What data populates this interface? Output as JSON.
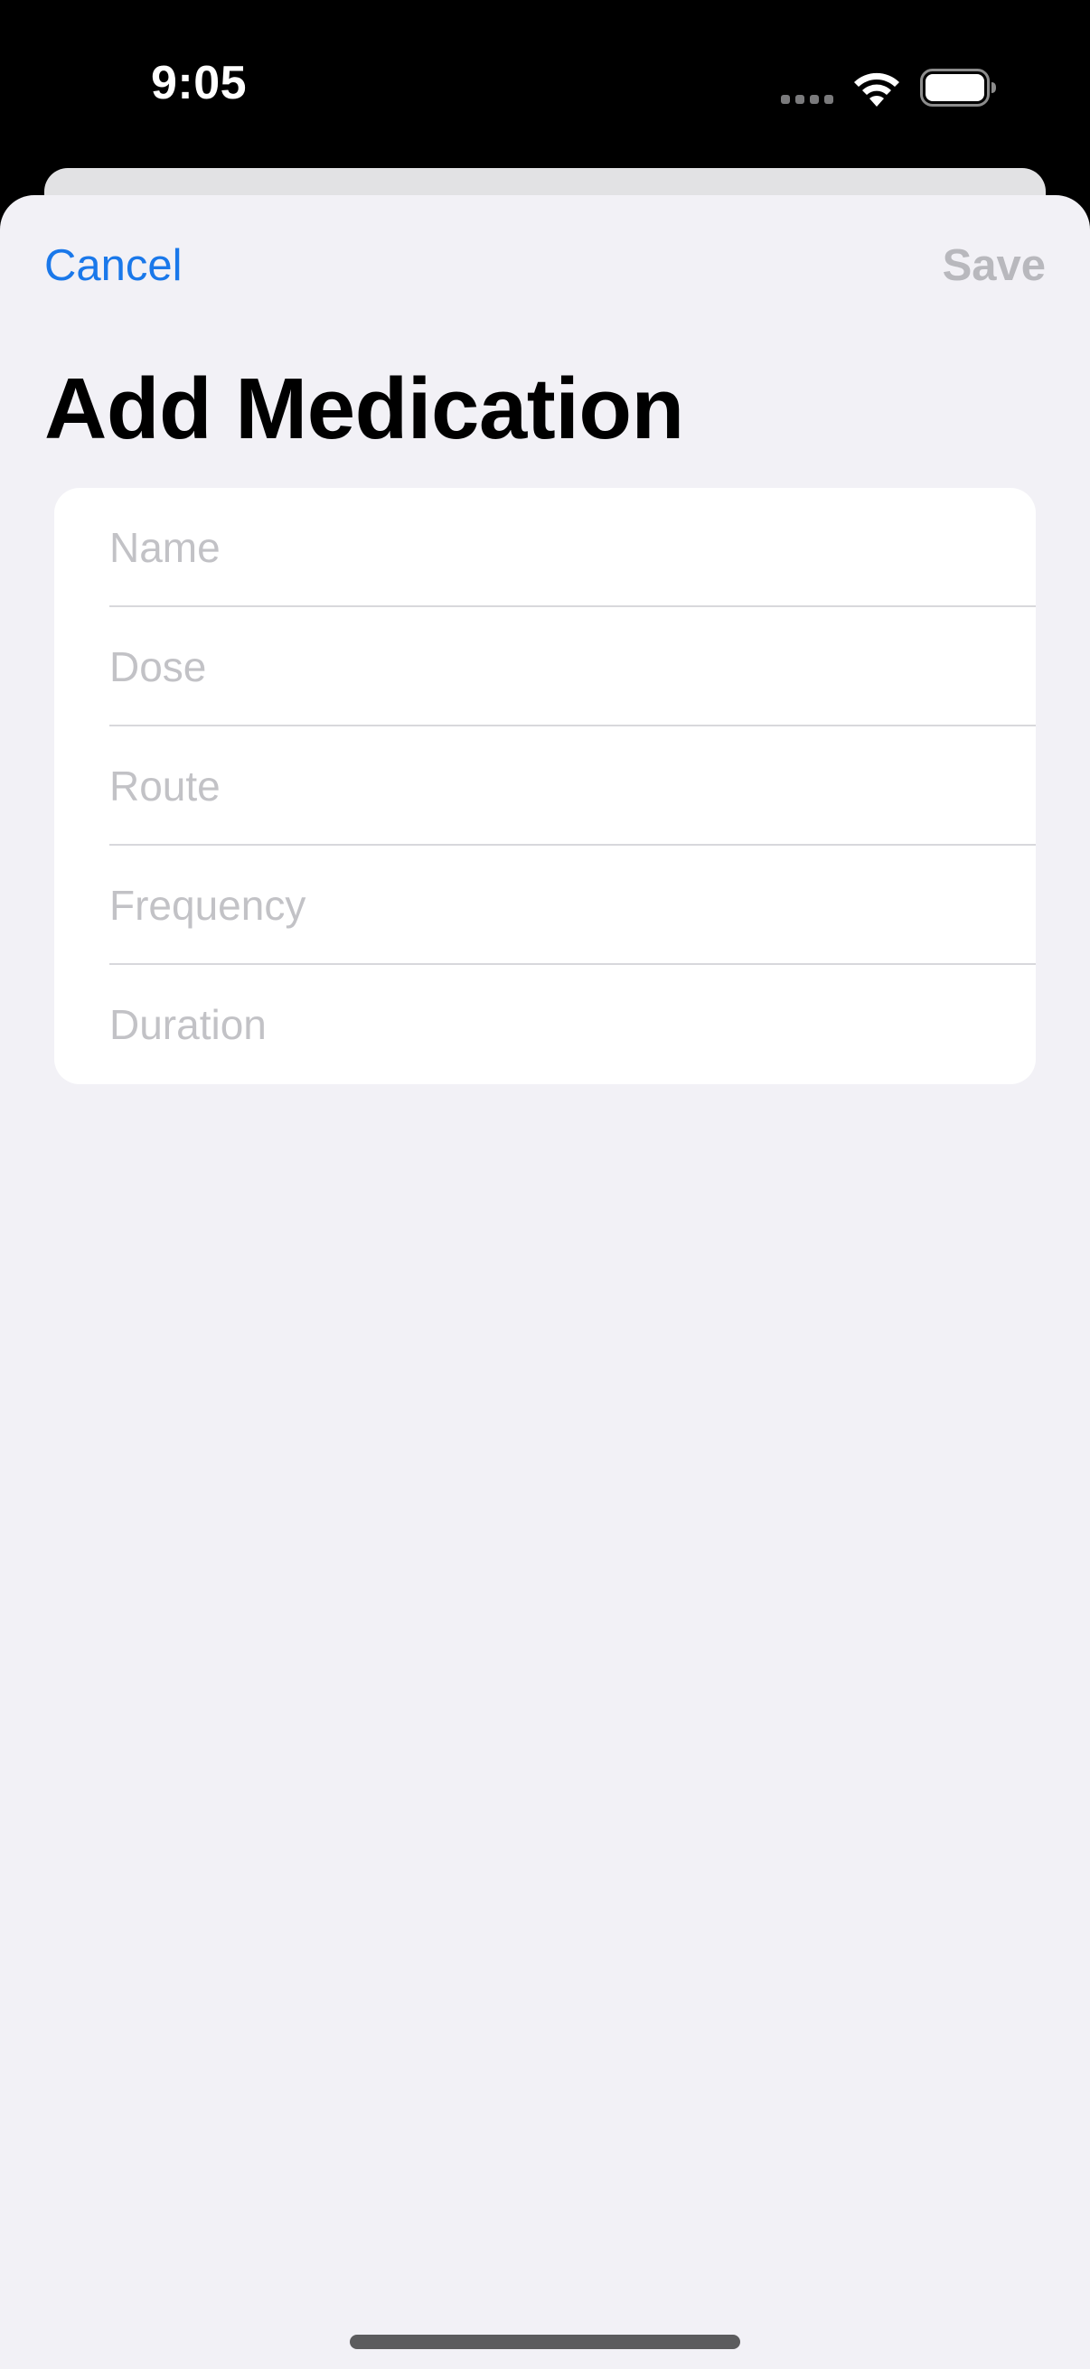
{
  "status_bar": {
    "time": "9:05",
    "icons": [
      "signal-icon",
      "wifi-icon",
      "battery-icon"
    ]
  },
  "nav": {
    "cancel_label": "Cancel",
    "save_label": "Save"
  },
  "page": {
    "title": "Add Medication"
  },
  "form": {
    "fields": [
      {
        "placeholder": "Name",
        "value": ""
      },
      {
        "placeholder": "Dose",
        "value": ""
      },
      {
        "placeholder": "Route",
        "value": ""
      },
      {
        "placeholder": "Frequency",
        "value": ""
      },
      {
        "placeholder": "Duration",
        "value": ""
      }
    ]
  },
  "colors": {
    "accent": "#1a78ea",
    "disabled": "#b8b8bd",
    "sheet_background": "#f2f1f6",
    "card_background": "#ffffff",
    "placeholder": "#c2c2c6"
  }
}
